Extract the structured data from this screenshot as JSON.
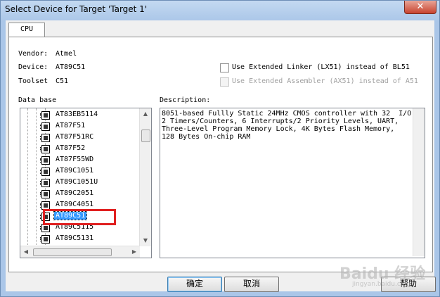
{
  "window": {
    "title": "Select Device for Target 'Target 1'",
    "close_glyph": "✕"
  },
  "tabs": [
    {
      "label": "CPU"
    }
  ],
  "device_info": {
    "vendor_label": "Vendor:",
    "vendor_value": "Atmel",
    "device_label": "Device:",
    "device_value": "AT89C51",
    "toolset_label": "Toolset",
    "toolset_value": "C51"
  },
  "options": {
    "linker_label": "Use Extended Linker (LX51) instead of BL51",
    "assembler_label": "Use Extended Assembler (AX51) instead of A51"
  },
  "database": {
    "label": "Data base",
    "items": [
      "AT83EB5114",
      "AT87F51",
      "AT87F51RC",
      "AT87F52",
      "AT87F55WD",
      "AT89C1051",
      "AT89C1051U",
      "AT89C2051",
      "AT89C4051",
      "AT89C51",
      "AT89C5115",
      "AT89C5131"
    ],
    "selected": "AT89C51"
  },
  "description": {
    "label": "Description:",
    "text": "8051-based Fullly Static 24MHz CMOS controller with 32  I/O\n2 Timers/Counters, 6 Interrupts/2 Priority Levels, UART,\nThree-Level Program Memory Lock, 4K Bytes Flash Memory,\n128 Bytes On-chip RAM"
  },
  "buttons": {
    "ok": "确定",
    "cancel": "取消",
    "help": "帮助"
  },
  "watermark": {
    "main": "Baidu 经验",
    "sub": "jingyan.baidu.com"
  },
  "icons": [
    "chip-icon",
    "scroll-up-icon",
    "scroll-down-icon",
    "scroll-left-icon",
    "scroll-right-icon",
    "close-icon"
  ],
  "colors": {
    "selection": "#3399ff",
    "highlight_box": "#e02020",
    "titlebar": "#aac6e8"
  }
}
